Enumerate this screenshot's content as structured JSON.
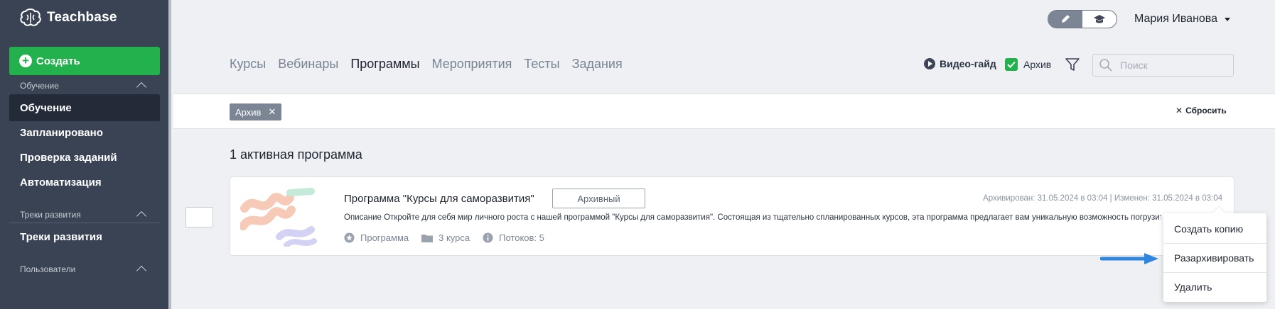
{
  "app": {
    "name": "Teachbase"
  },
  "sidebar": {
    "create_label": "Создать",
    "sections": [
      {
        "title": "Обучение",
        "items": [
          "Обучение",
          "Запланировано",
          "Проверка заданий",
          "Автоматизация"
        ]
      },
      {
        "title": "Треки развития",
        "items": [
          "Треки развития"
        ]
      },
      {
        "title": "Пользователи",
        "items": []
      }
    ],
    "active_item": "Обучение"
  },
  "header": {
    "user_name": "Мария Иванова",
    "mode_toggle": {
      "options": [
        "edit-icon",
        "graduation-cap-icon"
      ],
      "selected": "edit-icon"
    }
  },
  "tabs": [
    "Курсы",
    "Вебинары",
    "Программы",
    "Мероприятия",
    "Тесты",
    "Задания"
  ],
  "active_tab": "Программы",
  "toolbar": {
    "video_guide": "Видео-гайд",
    "archive_label": "Архив",
    "archive_checked": true,
    "search_placeholder": "Поиск"
  },
  "filters": {
    "chips": [
      "Архив"
    ],
    "reset_label": "Сбросить"
  },
  "list": {
    "count_title": "1 активная программа",
    "items": [
      {
        "title": "Программа \"Курсы для саморазвития\"",
        "badge": "Архивный",
        "dates": "Архивирован: 31.05.2024 в 03:04 | Изменен: 31.05.2024 в 03:04",
        "description": "Описание Откройте для себя мир личного роста с нашей программой \"Курсы для саморазвития\". Состоящая из тщательно спланированных курсов, эта программа предлагает вам уникальную возможность погрузиться",
        "meta": {
          "type": "Программа",
          "courses": "3 курса",
          "streams": "Потоков: 5"
        }
      }
    ]
  },
  "context_menu": {
    "items": [
      "Создать копию",
      "Разархивировать",
      "Удалить"
    ],
    "highlighted": "Разархивировать"
  },
  "colors": {
    "sidebar_bg": "#3a4354",
    "sidebar_active": "#232b38",
    "accent_green": "#22b14c",
    "arrow_blue": "#2f86e0",
    "chip_bg": "#7c8593"
  }
}
